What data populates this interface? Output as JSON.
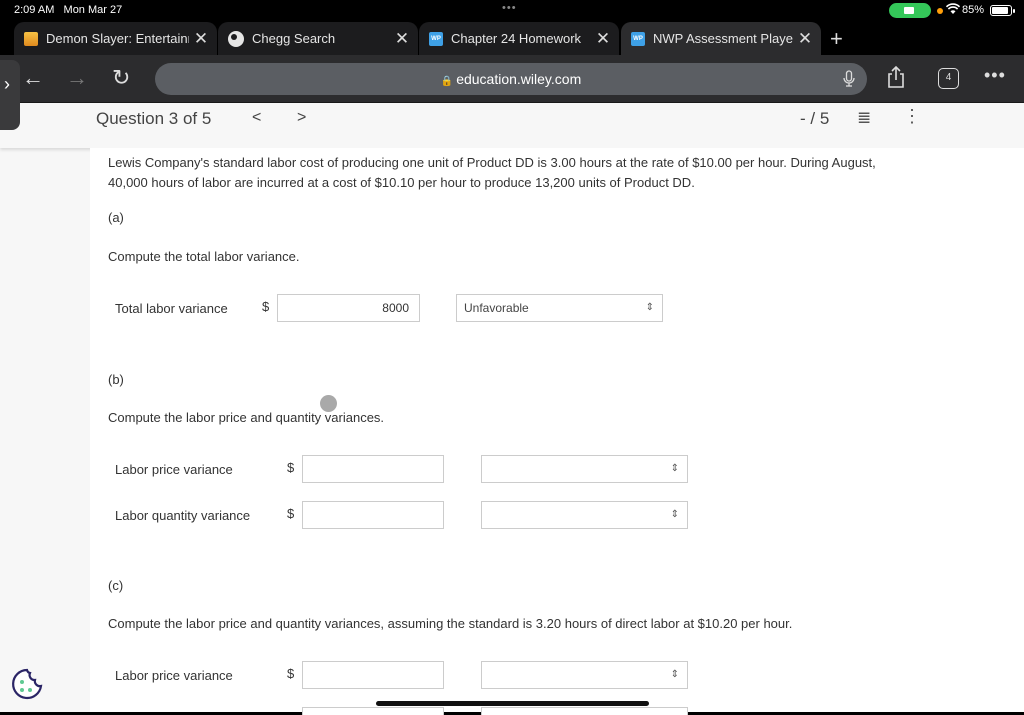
{
  "status_bar": {
    "time": "2:09 AM",
    "date": "Mon Mar 27",
    "battery_percent": "85%",
    "multitask_dots": "•••"
  },
  "tabs": [
    {
      "label": "Demon Slayer: Entertainm",
      "icon": "demon-slayer-favicon",
      "active": false
    },
    {
      "label": "Chegg Search",
      "icon": "globe-icon",
      "active": false
    },
    {
      "label": "Chapter 24 Homework",
      "icon": "wp-favicon",
      "active": false
    },
    {
      "label": "NWP Assessment Player",
      "icon": "wp-favicon",
      "active": true
    }
  ],
  "favicon_text": "WP",
  "toolbar": {
    "url": "education.wiley.com",
    "tab_count": "4",
    "back": "←",
    "forward": "→",
    "reload": "↻",
    "new_tab": "+",
    "close_glyph": "✕",
    "more": "•••",
    "share": "⇧",
    "mic": "🎙",
    "lock": "🔒",
    "sidebar_handle": "›"
  },
  "question_header": {
    "title": "Question 3 of 5",
    "prev": "<",
    "next": ">",
    "score": "- / 5",
    "list_icon": "≣",
    "kebab": "⋮"
  },
  "problem": {
    "intro": "Lewis Company's standard labor cost of producing one unit of Product DD is 3.00 hours at the rate of $10.00 per hour. During August, 40,000 hours of labor are incurred at a cost of $10.10 per hour to produce 13,200 units of Product DD.",
    "currency": "$",
    "select_chevron": "⇕",
    "parts": [
      {
        "label": "(a)",
        "prompt": "Compute the total labor variance.",
        "rows": [
          {
            "label": "Total labor variance",
            "value": "8000",
            "selection": "Unfavorable"
          }
        ]
      },
      {
        "label": "(b)",
        "prompt": "Compute the labor price and quantity variances.",
        "rows": [
          {
            "label": "Labor price variance",
            "value": "",
            "selection": ""
          },
          {
            "label": "Labor quantity variance",
            "value": "",
            "selection": ""
          }
        ]
      },
      {
        "label": "(c)",
        "prompt": "Compute the labor price and quantity variances, assuming the standard is 3.20 hours of direct labor at $10.20 per hour.",
        "rows": [
          {
            "label": "Labor price variance",
            "value": "",
            "selection": ""
          }
        ]
      }
    ]
  },
  "colors": {
    "accent_green": "#34c759",
    "wp_blue": "#3ea0e6",
    "cookie_outline": "#2b2566",
    "cookie_dots": "#5fc992"
  }
}
